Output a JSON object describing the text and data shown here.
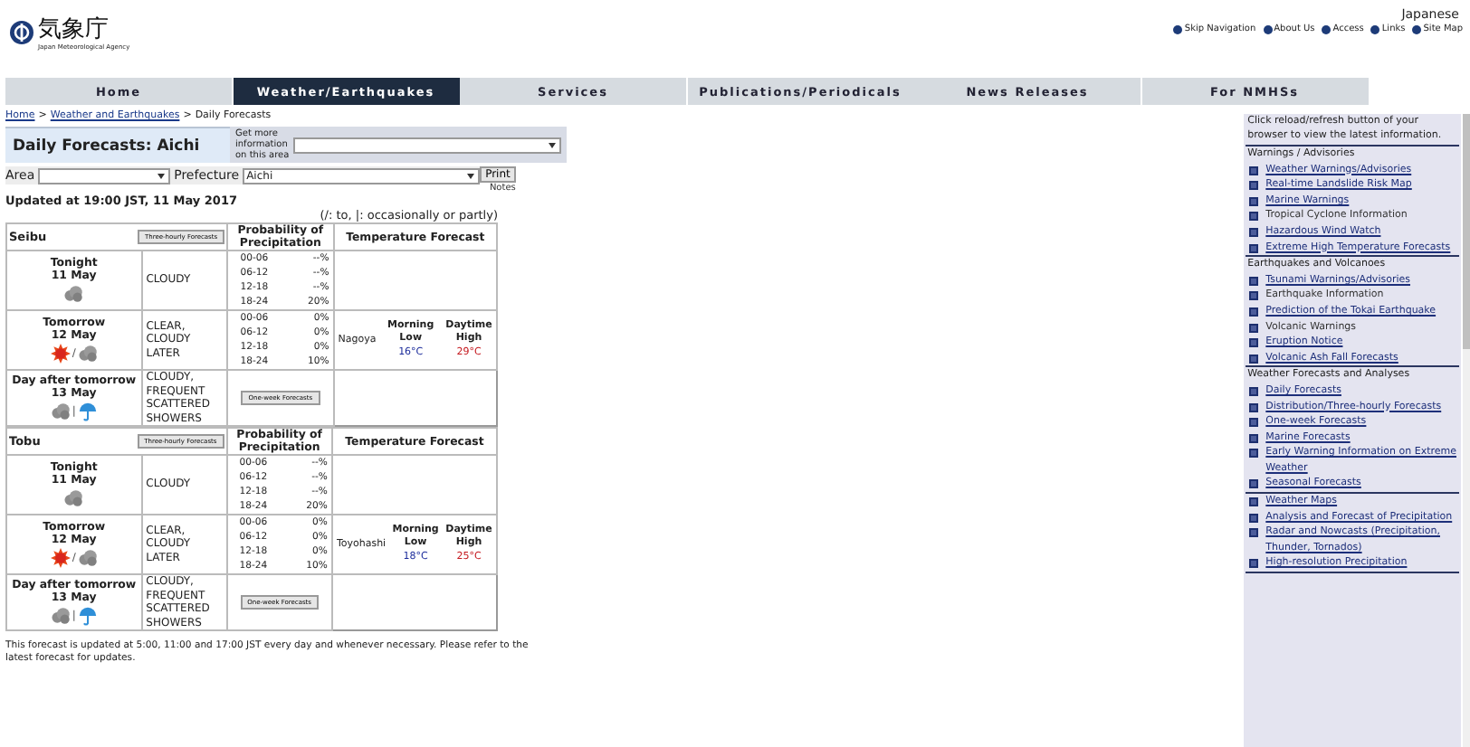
{
  "header": {
    "logo_text": "気象庁",
    "logo_subtitle": "Japan Meteorological Agency",
    "language_link": "Japanese",
    "utility_links": [
      "Skip Navigation",
      "About Us",
      "Access",
      "Links",
      "Site Map"
    ]
  },
  "nav": [
    {
      "label": "Home",
      "selected": false
    },
    {
      "label": "Weather/Earthquakes",
      "selected": true
    },
    {
      "label": "Services",
      "selected": false
    },
    {
      "label": "Publications/Periodicals",
      "selected": false
    },
    {
      "label": "News Releases",
      "selected": false
    },
    {
      "label": "For NMHSs",
      "selected": false
    }
  ],
  "breadcrumb": {
    "separator": ">",
    "items": [
      {
        "label": "Home",
        "kind": "link"
      },
      {
        "label": "Weather and Earthquakes",
        "kind": "link"
      },
      {
        "label": "Daily Forecasts",
        "kind": "current"
      }
    ]
  },
  "page_title": "Daily Forecasts: Aichi",
  "more_info": {
    "label": "Get more information on this area"
  },
  "area": {
    "label": "Area"
  },
  "prefecture": {
    "label": "Prefecture",
    "value": "Aichi"
  },
  "print_button": "Print",
  "notes_link": "Notes",
  "updated": "Updated at 19:00 JST, 11 May 2017",
  "legend": "(/: to, |: occasionally or partly)",
  "regions": [
    {
      "name": "Seibu",
      "button": "Three-hourly Forecasts",
      "pop_header": "Probability of Precipitation",
      "temp_header": "Temperature Forecast",
      "days": [
        {
          "label": "Tonight",
          "date": "11 May",
          "icons": [
            {
              "kind": "cloud"
            }
          ],
          "weather": "CLOUDY",
          "pop": [
            [
              "00-06",
              "--%"
            ],
            [
              "06-12",
              "--%"
            ],
            [
              "12-18",
              "--%"
            ],
            [
              "18-24",
              "20%"
            ]
          ]
        },
        {
          "label": "Tomorrow",
          "date": "12 May",
          "icons": [
            {
              "kind": "sun"
            },
            {
              "kind": "cloud"
            }
          ],
          "separator": "/",
          "weather": "CLEAR, CLOUDY LATER",
          "pop": [
            [
              "00-06",
              "0%"
            ],
            [
              "06-12",
              "0%"
            ],
            [
              "12-18",
              "0%"
            ],
            [
              "18-24",
              "10%"
            ]
          ],
          "temp": {
            "city": "Nagoya",
            "low_label": "Morning Low",
            "high_label": "Daytime High",
            "low": "16°C",
            "high": "29°C"
          }
        },
        {
          "label": "Day after tomorrow",
          "date": "13 May",
          "icons": [
            {
              "kind": "cloud"
            },
            {
              "kind": "umbrella"
            }
          ],
          "separator": "|",
          "weather": "CLOUDY, FREQUENT SCATTERED SHOWERS",
          "week_button": "One-week Forecasts"
        }
      ]
    },
    {
      "name": "Tobu",
      "button": "Three-hourly Forecasts",
      "pop_header": "Probability of Precipitation",
      "temp_header": "Temperature Forecast",
      "days": [
        {
          "label": "Tonight",
          "date": "11 May",
          "icons": [
            {
              "kind": "cloud"
            }
          ],
          "weather": "CLOUDY",
          "pop": [
            [
              "00-06",
              "--%"
            ],
            [
              "06-12",
              "--%"
            ],
            [
              "12-18",
              "--%"
            ],
            [
              "18-24",
              "20%"
            ]
          ]
        },
        {
          "label": "Tomorrow",
          "date": "12 May",
          "icons": [
            {
              "kind": "sun"
            },
            {
              "kind": "cloud"
            }
          ],
          "separator": "/",
          "weather": "CLEAR, CLOUDY LATER",
          "pop": [
            [
              "00-06",
              "0%"
            ],
            [
              "06-12",
              "0%"
            ],
            [
              "12-18",
              "0%"
            ],
            [
              "18-24",
              "10%"
            ]
          ],
          "temp": {
            "city": "Toyohashi",
            "low_label": "Morning Low",
            "high_label": "Daytime High",
            "low": "18°C",
            "high": "25°C"
          }
        },
        {
          "label": "Day after tomorrow",
          "date": "13 May",
          "icons": [
            {
              "kind": "cloud"
            },
            {
              "kind": "umbrella"
            }
          ],
          "separator": "|",
          "weather": "CLOUDY, FREQUENT SCATTERED SHOWERS",
          "week_button": "One-week Forecasts"
        }
      ]
    }
  ],
  "footer_note": "This forecast is updated at 5:00, 11:00 and 17:00 JST every day and whenever necessary. Please refer to the latest forecast for updates.",
  "sidebar": {
    "notice": "Click reload/refresh button of your browser to view the latest information.",
    "sections": [
      {
        "title": "Warnings / Advisories",
        "items": [
          {
            "label": "Weather Warnings/Advisories",
            "kind": "link"
          },
          {
            "label": "Real-time Landslide Risk Map",
            "kind": "link"
          },
          {
            "label": "Marine Warnings",
            "kind": "link"
          },
          {
            "label": "Tropical Cyclone Information",
            "kind": "plain"
          },
          {
            "label": "Hazardous Wind Watch",
            "kind": "link"
          },
          {
            "label": "Extreme High Temperature Forecasts",
            "kind": "link"
          }
        ]
      },
      {
        "title": "Earthquakes and Volcanoes",
        "items": [
          {
            "label": "Tsunami Warnings/Advisories",
            "kind": "link"
          },
          {
            "label": "Earthquake Information",
            "kind": "plain"
          },
          {
            "label": "Prediction of the Tokai Earthquake",
            "kind": "link"
          },
          {
            "label": "Volcanic Warnings",
            "kind": "plain"
          },
          {
            "label": "Eruption Notice",
            "kind": "link"
          },
          {
            "label": "Volcanic Ash Fall Forecasts",
            "kind": "link"
          }
        ]
      },
      {
        "title": "Weather Forecasts and Analyses",
        "items": [
          {
            "label": "Daily Forecasts",
            "kind": "link"
          },
          {
            "label": "Distribution/Three-hourly Forecasts",
            "kind": "link"
          },
          {
            "label": "One-week Forecasts",
            "kind": "link"
          },
          {
            "label": "Marine Forecasts",
            "kind": "link"
          },
          {
            "label": "Early Warning Information on Extreme Weather",
            "kind": "link"
          },
          {
            "label": "Seasonal Forecasts",
            "kind": "link"
          }
        ]
      },
      {
        "items": [
          {
            "label": "Weather Maps",
            "kind": "link"
          },
          {
            "label": "Analysis and Forecast of Precipitation",
            "kind": "link"
          },
          {
            "label": "Radar and Nowcasts (Precipitation, Thunder, Tornados)",
            "kind": "link"
          },
          {
            "label": "High-resolution Precipitation",
            "kind": "link"
          }
        ]
      }
    ]
  }
}
